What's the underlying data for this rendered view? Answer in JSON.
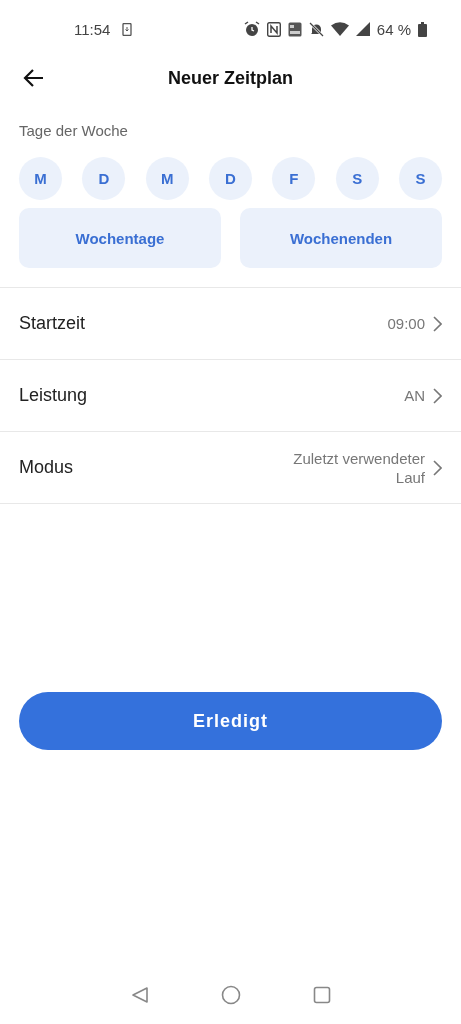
{
  "status_bar": {
    "time": "11:54",
    "battery": "64 %"
  },
  "header": {
    "title": "Neuer Zeitplan"
  },
  "days_label": "Tage der Woche",
  "days": [
    {
      "label": "M",
      "selected": false
    },
    {
      "label": "D",
      "selected": false
    },
    {
      "label": "M",
      "selected": false
    },
    {
      "label": "D",
      "selected": false
    },
    {
      "label": "F",
      "selected": false
    },
    {
      "label": "S",
      "selected": false
    },
    {
      "label": "S",
      "selected": false
    }
  ],
  "presets": [
    {
      "label": "Wochentage",
      "selected": false
    },
    {
      "label": "Wochenenden",
      "selected": false
    }
  ],
  "settings": [
    {
      "label": "Startzeit",
      "value": "09:00"
    },
    {
      "label": "Leistung",
      "value": "AN"
    },
    {
      "label": "Modus",
      "value": "Zuletzt verwendeter Lauf"
    }
  ],
  "done_button": "Erledigt"
}
